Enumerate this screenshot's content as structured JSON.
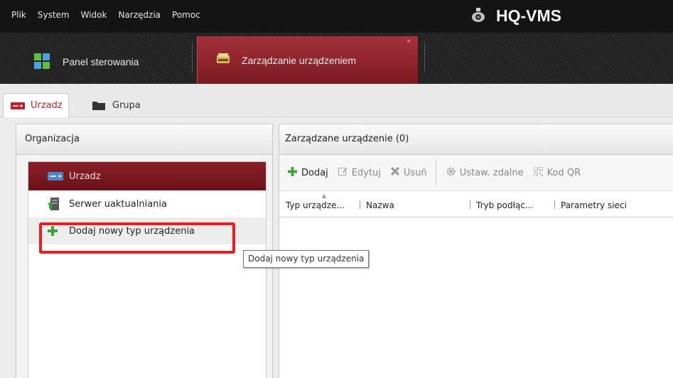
{
  "menu": [
    "Plik",
    "System",
    "Widok",
    "Narzędzia",
    "Pomoc"
  ],
  "app_title": "HQ-VMS",
  "tabs": {
    "panel": "Panel sterowania",
    "device_mgmt": "Zarządzanie urządzeniem",
    "close": "×"
  },
  "subtabs": {
    "device": "Urzadz",
    "group": "Grupa"
  },
  "left": {
    "header": "Organizacja",
    "items": [
      "Urzadz",
      "Serwer uaktualniania",
      "Dodaj nowy typ urządzenia"
    ]
  },
  "tooltip": "Dodaj nowy typ urządzenia",
  "right": {
    "header": "Zarządzane urządzenie (0)",
    "toolbar": {
      "add": "Dodaj",
      "edit": "Edytuj",
      "delete": "Usuń",
      "remote": "Ustaw. zdalne",
      "qr": "Kod QR"
    },
    "columns": [
      "Typ urządze...",
      "Nazwa",
      "Tryb podłąc...",
      "Parametry sieci"
    ]
  },
  "colors": {
    "accent": "#b5222b",
    "highlight": "#ee1c1c",
    "add_green": "#3aa33a"
  }
}
